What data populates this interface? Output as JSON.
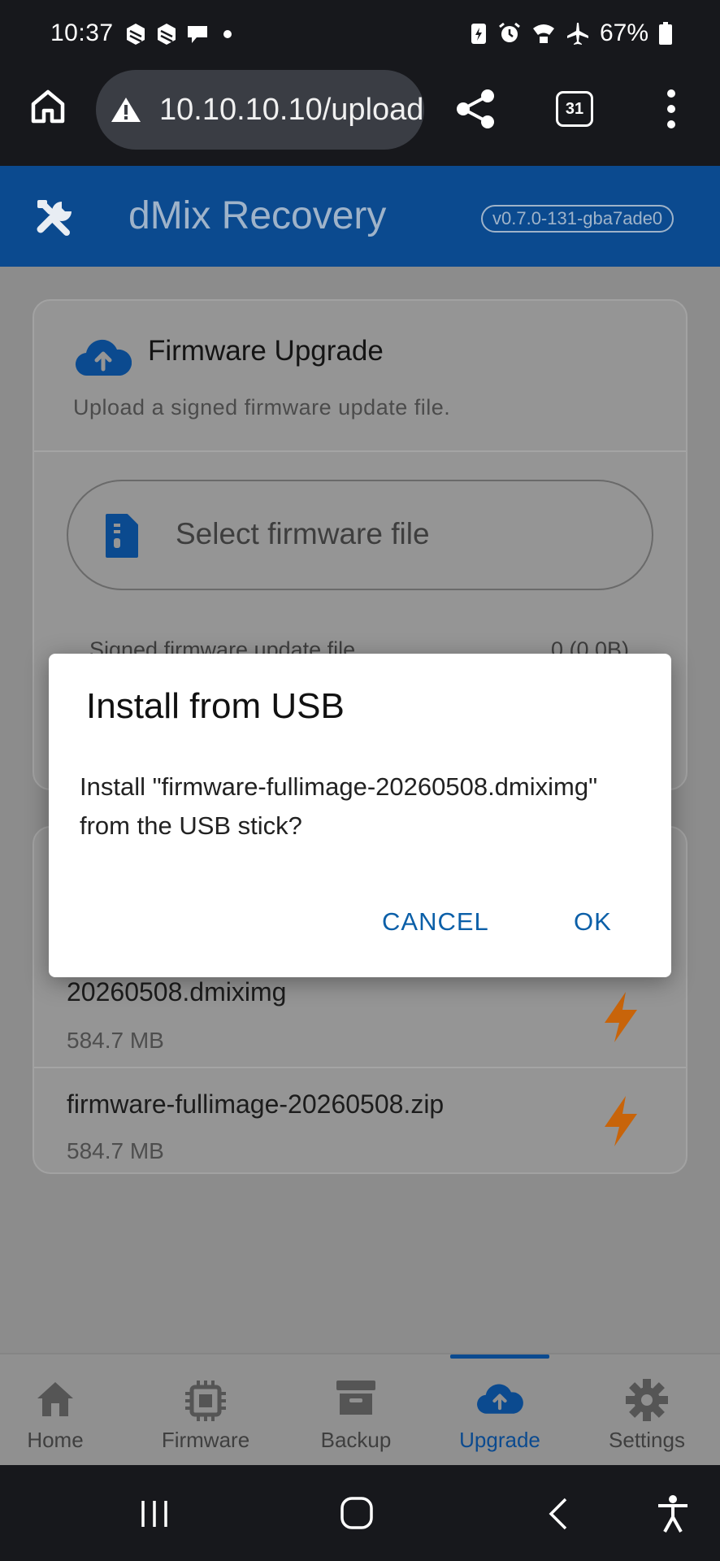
{
  "status_bar": {
    "time": "10:37",
    "battery_pct": "67%",
    "left_icons": [
      "notification-app-icon",
      "notification-app-icon",
      "chat-icon",
      "dot-icon"
    ],
    "right_icons": [
      "battery-saver-icon",
      "alarm-icon",
      "wifi-calling-icon",
      "airplane-icon",
      "battery-icon"
    ]
  },
  "browser": {
    "url": "10.10.10.10/upload",
    "tab_count": "31"
  },
  "header": {
    "title": "dMix Recovery",
    "version": "v0.7.0-131-gba7ade0"
  },
  "upgrade_card": {
    "title": "Firmware Upgrade",
    "subtitle": "Upload a signed firmware update file.",
    "select_label": "Select firmware file",
    "file_caption": "Signed firmware update file",
    "file_size": "0 (0.0B)"
  },
  "usb_files": [
    {
      "name": "20260508.dmiximg",
      "size": "584.7 MB"
    },
    {
      "name": "firmware-fullimage-20260508.zip",
      "size": "584.7 MB"
    }
  ],
  "dialog": {
    "title": "Install from USB",
    "body": "Install \"firmware-fullimage-20260508.dmiximg\" from the USB stick?",
    "cancel_label": "CANCEL",
    "ok_label": "OK"
  },
  "bottom_nav": {
    "items": [
      {
        "label": "Home",
        "icon": "home-icon"
      },
      {
        "label": "Firmware",
        "icon": "chip-icon"
      },
      {
        "label": "Backup",
        "icon": "archive-icon"
      },
      {
        "label": "Upgrade",
        "icon": "cloud-upload-icon"
      },
      {
        "label": "Settings",
        "icon": "gear-icon"
      }
    ],
    "active": "Upgrade"
  },
  "colors": {
    "brand": "#0b4a8f",
    "accent_bolt": "#c8640a",
    "dialog_action": "#0b5fa8"
  }
}
